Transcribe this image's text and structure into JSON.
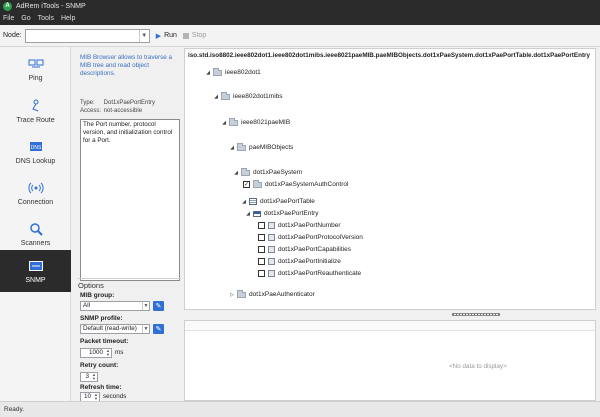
{
  "window": {
    "title": "AdRem iTools - SNMP"
  },
  "menu": [
    "File",
    "Go",
    "Tools",
    "Help"
  ],
  "toolbar": {
    "node_label": "Node:",
    "node_value": "",
    "run_label": "Run",
    "stop_label": "Stop"
  },
  "sidebar": {
    "items": [
      {
        "label": "Ping",
        "icon": "ping-icon"
      },
      {
        "label": "Trace Route",
        "icon": "trace-route-icon"
      },
      {
        "label": "DNS Lookup",
        "icon": "dns-icon"
      },
      {
        "label": "Connection",
        "icon": "connection-icon"
      },
      {
        "label": "Scanners",
        "icon": "scanners-icon"
      },
      {
        "label": "SNMP",
        "icon": "snmp-icon",
        "active": true
      }
    ]
  },
  "info": {
    "intro": "MIB Browser allows to traverse a MIB tree and read object descriptions.",
    "type_label": "Type:",
    "type_value": "Dot1xPaePortEntry",
    "access_label": "Access:",
    "access_value": "not-accessible",
    "description": "The Port number, protocol version, and initialization control for a Port."
  },
  "options": {
    "title": "Options",
    "mib_group_label": "MIB group:",
    "mib_group_value": "All",
    "snmp_profile_label": "SNMP profile:",
    "snmp_profile_value": "Default (read-write)",
    "packet_timeout_label": "Packet timeout:",
    "packet_timeout_value": "1000",
    "packet_timeout_unit": "ms",
    "retry_label": "Retry count:",
    "retry_value": "3",
    "refresh_label": "Refresh time:",
    "refresh_value": "10",
    "refresh_unit": "seconds"
  },
  "tree": {
    "path": "iso.std.iso8802.ieee802dot1.ieee802dot1mibs.ieee8021paeMIB.paeMIBObjects.dot1xPaeSystem.dot1xPaePortTable.dot1xPaePortEntry",
    "nodes": {
      "ieee802dot1": "ieee802dot1",
      "ieee802dot1mibs": "ieee802dot1mibs",
      "ieee8021paeMIB": "ieee8021paeMIB",
      "paeMIBObjects": "paeMIBObjects",
      "dot1xPaeSystem": "dot1xPaeSystem",
      "dot1xPaeSystemAuthControl": "dot1xPaeSystemAuthControl",
      "dot1xPaePortTable": "dot1xPaePortTable",
      "dot1xPaePortEntry": "dot1xPaePortEntry",
      "dot1xPaePortNumber": "dot1xPaePortNumber",
      "dot1xPaePortProtocolVersion": "dot1xPaePortProtocolVersion",
      "dot1xPaePortCapabilities": "dot1xPaePortCapabilities",
      "dot1xPaePortInitialize": "dot1xPaePortInitialize",
      "dot1xPaePortReauthenticate": "dot1xPaePortReauthenticate",
      "dot1xPaeAuthenticator": "dot1xPaeAuthenticator"
    },
    "checked": {
      "dot1xPaeSystemAuthControl": true
    }
  },
  "results": {
    "empty_text": "<No data to display>"
  },
  "status": {
    "text": "Ready."
  }
}
